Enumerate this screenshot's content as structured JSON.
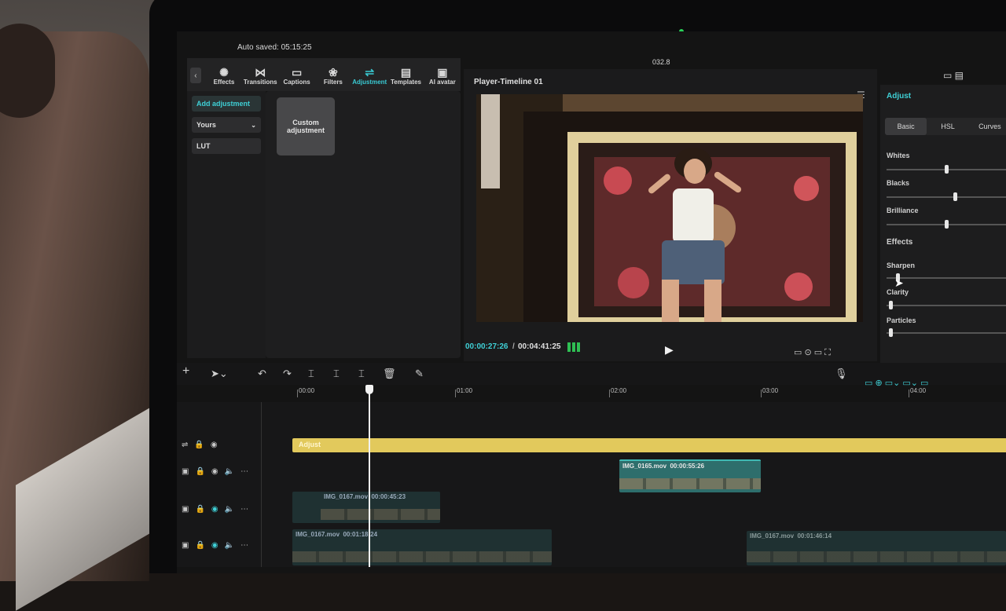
{
  "autosave": "Auto saved: 05:15:25",
  "window_center": "032.8",
  "tabs": [
    {
      "label": "Effects",
      "icon": "effects-icon",
      "glyph": "✺"
    },
    {
      "label": "Transitions",
      "icon": "transitions-icon",
      "glyph": "⋈"
    },
    {
      "label": "Captions",
      "icon": "captions-icon",
      "glyph": "▭"
    },
    {
      "label": "Filters",
      "icon": "filters-icon",
      "glyph": "❀"
    },
    {
      "label": "Adjustment",
      "icon": "adjustment-icon",
      "glyph": "⇌"
    },
    {
      "label": "Templates",
      "icon": "templates-icon",
      "glyph": "▤"
    },
    {
      "label": "AI avatar",
      "icon": "ai-avatar-icon",
      "glyph": "▣"
    }
  ],
  "left": {
    "add_adjustment": "Add adjustment",
    "yours": "Yours",
    "lut": "LUT",
    "custom_adjustment": "Custom adjustment"
  },
  "player": {
    "title": "Player-Timeline 01",
    "current_time": "00:00:27:26",
    "total_time": "00:04:41:25"
  },
  "adjust": {
    "title": "Adjust",
    "tabs": [
      "Basic",
      "HSL",
      "Curves"
    ],
    "section_effects": "Effects",
    "sliders": [
      {
        "label": "Whites",
        "value": 0.48
      },
      {
        "label": "Blacks",
        "value": 0.55
      },
      {
        "label": "Brilliance",
        "value": 0.48
      }
    ],
    "effect_sliders": [
      {
        "label": "Sharpen",
        "value": 0.08
      },
      {
        "label": "Clarity",
        "value": 0.02
      },
      {
        "label": "Particles",
        "value": 0.02
      }
    ]
  },
  "ruler": [
    "00:00",
    "01:00",
    "02:00",
    "03:00",
    "04:00"
  ],
  "timeline": {
    "adjust_clip": "Adjust",
    "clip1": {
      "name": "IMG_0165.mov",
      "duration": "00:00:55:26"
    },
    "clip2": {
      "name": "IMG_0167.mov",
      "duration": "00:00:45:23"
    },
    "clip3": {
      "name": "IMG_0167.mov",
      "duration": "00:01:18:24"
    },
    "clip4": {
      "name": "IMG_0167.mov",
      "duration": "00:01:46:14"
    }
  }
}
